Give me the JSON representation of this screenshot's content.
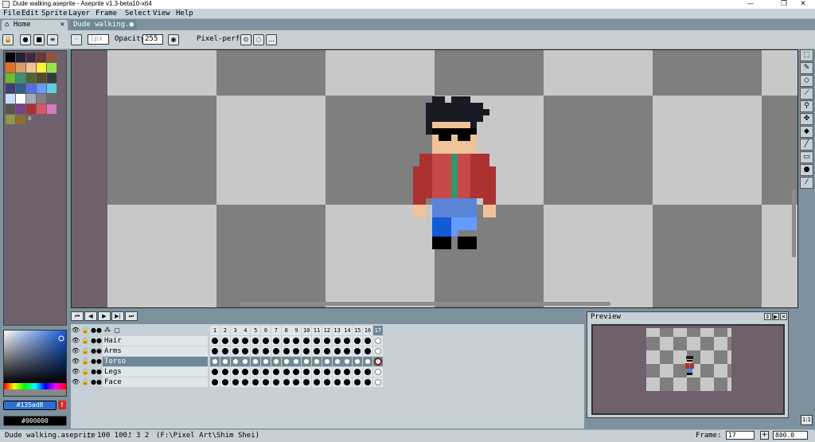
{
  "window": {
    "title": "Dude walking.aseprite - Aseprite v1.3-beta10-x64",
    "minimize": "—",
    "maximize": "❐",
    "close": "✕"
  },
  "menu": [
    "File",
    "Edit",
    "Sprite",
    "Layer",
    "Frame",
    "Select",
    "View",
    "Help"
  ],
  "tabs": {
    "home": "Home",
    "home_close": "✕",
    "doc": "Dude walking.a",
    "doc_close": "●"
  },
  "context": {
    "brush_size": "1px",
    "opacity_label": "Opacity:",
    "opacity_value": "255",
    "pixel_perfect_label": "Pixel-perfect",
    "more": "..."
  },
  "palette": {
    "colors": [
      "#000000",
      "#222034",
      "#45283c",
      "#663931",
      "#8f563b",
      "#df7126",
      "#d9a066",
      "#eec39a",
      "#fbf236",
      "#99e550",
      "#6abe30",
      "#37946e",
      "#4b692f",
      "#524b24",
      "#323c39",
      "#3f3f74",
      "#306082",
      "#5b6ee1",
      "#639bff",
      "#5fcde4",
      "#cbdbfc",
      "#ffffff",
      "#9badb7",
      "#847e87",
      "#696a6a",
      "#595652",
      "#76428a",
      "#ac3232",
      "#d95763",
      "#d77bba",
      "#8f974a",
      "#8a6f30"
    ],
    "index_marker": "8"
  },
  "colors": {
    "foreground": "#135ad8",
    "background": "#000000",
    "warning": "!"
  },
  "tools": [
    {
      "name": "marquee-tool",
      "glyph": "⬚"
    },
    {
      "name": "pencil-tool",
      "glyph": "✎"
    },
    {
      "name": "eraser-tool",
      "glyph": "◇"
    },
    {
      "name": "eyedropper-tool",
      "glyph": "⟋"
    },
    {
      "name": "zoom-tool",
      "glyph": "⚲"
    },
    {
      "name": "move-tool",
      "glyph": "✥"
    },
    {
      "name": "fill-tool",
      "glyph": "◆"
    },
    {
      "name": "line-tool",
      "glyph": "╱"
    },
    {
      "name": "rectangle-tool",
      "glyph": "▭"
    },
    {
      "name": "contour-tool",
      "glyph": "●"
    },
    {
      "name": "blur-tool",
      "glyph": "⁄"
    }
  ],
  "timeline": {
    "controls": [
      "⏮",
      "◀",
      "▶",
      "▶|",
      "⏭"
    ],
    "header_icons": [
      "👁",
      "🔒",
      "●●",
      "⁂",
      "▢"
    ],
    "frames": [
      "1",
      "2",
      "3",
      "4",
      "5",
      "6",
      "7",
      "8",
      "9",
      "10",
      "11",
      "12",
      "13",
      "14",
      "15",
      "16",
      "17"
    ],
    "current_frame_index": 16,
    "layers": [
      {
        "name": "Hair",
        "selected": false
      },
      {
        "name": "Arms",
        "selected": false
      },
      {
        "name": "Torso",
        "selected": true
      },
      {
        "name": "Legs",
        "selected": false
      },
      {
        "name": "Face",
        "selected": false
      }
    ]
  },
  "preview": {
    "title": "Preview"
  },
  "status": {
    "filename": "Dude walking.aseprite",
    "size": "100 100",
    "frames": "3 2",
    "path": "(F:\\Pixel Art\\Shim Shei)",
    "frame_label": "Frame:",
    "frame_value": "17",
    "plus": "+",
    "zoom": "800.0",
    "one_to_one": "1:1"
  }
}
